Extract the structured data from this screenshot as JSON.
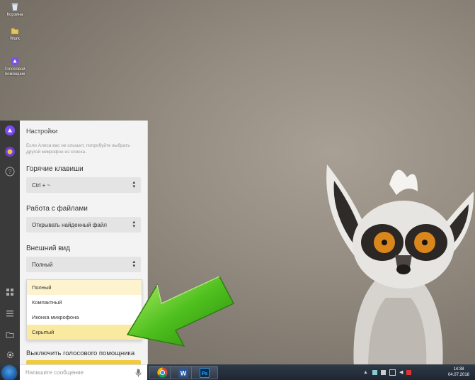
{
  "desktop": {
    "icons": [
      {
        "label": "Корзина"
      },
      {
        "label": "Work"
      },
      {
        "label": "Голосовой помощник"
      }
    ]
  },
  "alice": {
    "rail_icons": [
      "alice-logo-icon",
      "yandex-browser-icon",
      "help-icon",
      "apps-grid-icon",
      "list-icon",
      "folder-icon",
      "settings-gear-icon"
    ],
    "panel_title": "Настройки",
    "hint": "Если Алиса вас не слышит, попробуйте выбрать другой микрофон из списка.",
    "hotkeys": {
      "label": "Горячие клавиши",
      "value": "Ctrl + ~"
    },
    "files": {
      "label": "Работа с файлами",
      "value": "Открывать найденный файл"
    },
    "appearance": {
      "label": "Внешний вид",
      "value": "Полный",
      "options": [
        "Полный",
        "Компактный",
        "Иконка микрофона",
        "Скрытый"
      ],
      "hovered_option": "Скрытый"
    },
    "disable_label": "Выключить голосового помощника",
    "message_placeholder": "Напишите сообщение"
  },
  "taskbar": {
    "apps": [
      "chrome-icon",
      "word-icon",
      "photoshop-icon"
    ],
    "clock_time": "14:38",
    "clock_date": "04.07.2018"
  },
  "colors": {
    "accent_yellow": "#f2cb3d",
    "highlight_option": "#faeaa0",
    "arrow_green": "#4fc01e",
    "alice_purple": "#7b4cf0"
  }
}
